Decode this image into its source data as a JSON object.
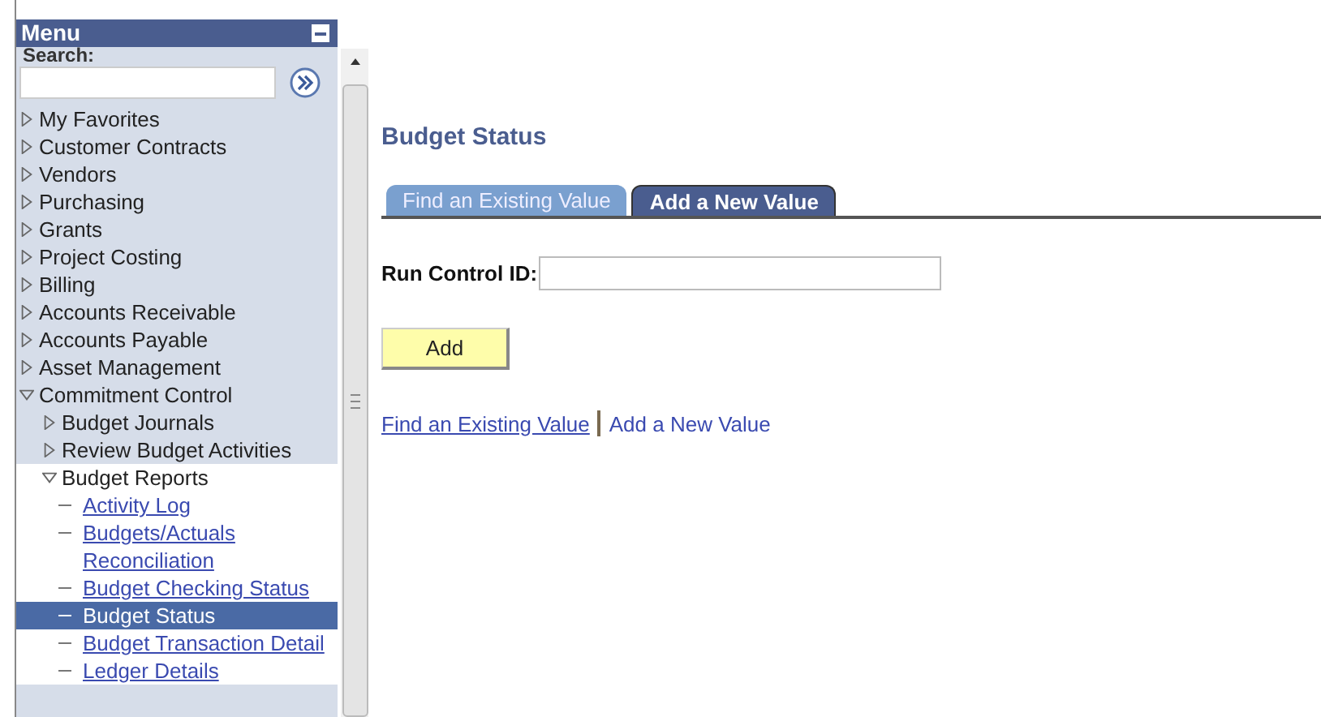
{
  "menu": {
    "title": "Menu",
    "search": {
      "label": "Search:"
    },
    "items": [
      {
        "label": "My Favorites",
        "expanded": false
      },
      {
        "label": "Customer Contracts",
        "expanded": false
      },
      {
        "label": "Vendors",
        "expanded": false
      },
      {
        "label": "Purchasing",
        "expanded": false
      },
      {
        "label": "Grants",
        "expanded": false
      },
      {
        "label": "Project Costing",
        "expanded": false
      },
      {
        "label": "Billing",
        "expanded": false
      },
      {
        "label": "Accounts Receivable",
        "expanded": false
      },
      {
        "label": "Accounts Payable",
        "expanded": false
      },
      {
        "label": "Asset Management",
        "expanded": false
      },
      {
        "label": "Commitment Control",
        "expanded": true,
        "children": [
          {
            "label": "Budget Journals",
            "expanded": false
          },
          {
            "label": "Review Budget Activities",
            "expanded": false
          },
          {
            "label": "Budget Reports",
            "expanded": true,
            "children": [
              {
                "label": "Activity Log",
                "kind": "link",
                "selected": false
              },
              {
                "label": "Budgets/Actuals Reconciliation",
                "kind": "link",
                "selected": false
              },
              {
                "label": "Budget Checking Status",
                "kind": "link",
                "selected": false
              },
              {
                "label": "Budget Status",
                "kind": "link",
                "selected": true
              },
              {
                "label": "Budget Transaction Detail",
                "kind": "link",
                "selected": false
              },
              {
                "label": "Ledger Details",
                "kind": "link",
                "selected": false
              }
            ]
          }
        ]
      }
    ]
  },
  "page": {
    "title": "Budget Status",
    "tabs": [
      {
        "label": "Find an Existing Value",
        "selected": false
      },
      {
        "label": "Add a New Value",
        "selected": true
      }
    ],
    "field": {
      "label": "Run Control ID:"
    },
    "button": "Add",
    "links": [
      "Find an Existing Value",
      "Add a New Value"
    ]
  }
}
